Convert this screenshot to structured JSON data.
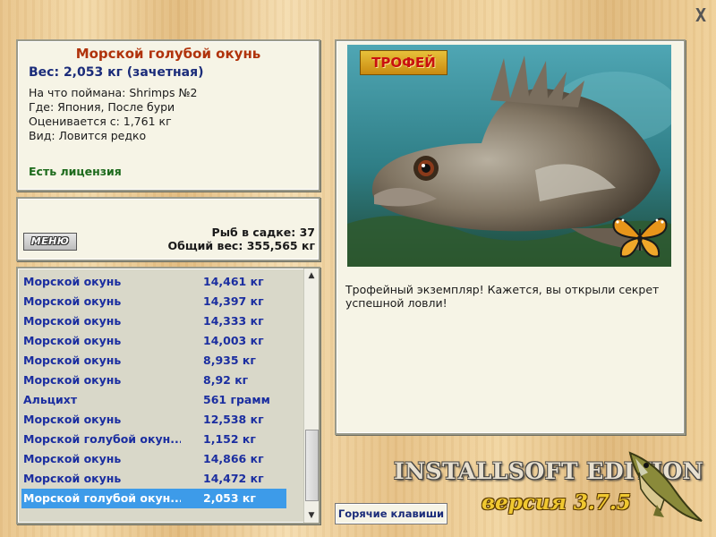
{
  "window": {
    "close_label": "X"
  },
  "info": {
    "fish_name": "Морской голубой окунь",
    "weight": "Вес: 2,053 кг (зачетная)",
    "bait": "На что поймана: Shrimps №2",
    "place": "Где: Япония, После бури",
    "estimated": "Оценивается с: 1,761 кг",
    "kind": "Вид: Ловится редко",
    "license": "Есть лицензия"
  },
  "menu": {
    "button_label": "МЕНЮ",
    "fish_in_keepnet": "Рыб в садке: 37",
    "total_weight": "Общий вес: 355,565 кг"
  },
  "catch_list": [
    {
      "name": "Морской окунь",
      "weight": "14,461 кг",
      "selected": false
    },
    {
      "name": "Морской окунь",
      "weight": "14,397 кг",
      "selected": false
    },
    {
      "name": "Морской окунь",
      "weight": "14,333 кг",
      "selected": false
    },
    {
      "name": "Морской окунь",
      "weight": "14,003 кг",
      "selected": false
    },
    {
      "name": "Морской окунь",
      "weight": "8,935 кг",
      "selected": false
    },
    {
      "name": "Морской окунь",
      "weight": "8,92 кг",
      "selected": false
    },
    {
      "name": "Альцихт",
      "weight": "561 грамм",
      "selected": false
    },
    {
      "name": "Морской окунь",
      "weight": "12,538 кг",
      "selected": false
    },
    {
      "name": "Морской голубой окун...",
      "weight": "1,152 кг",
      "selected": false
    },
    {
      "name": "Морской окунь",
      "weight": "14,866 кг",
      "selected": false
    },
    {
      "name": "Морской окунь",
      "weight": "14,472 кг",
      "selected": false
    },
    {
      "name": "Морской голубой окун...",
      "weight": "2,053 кг",
      "selected": true
    }
  ],
  "trophy": {
    "badge": "ТРОФЕЙ",
    "description": "Трофейный экземпляр! Кажется, вы открыли секрет успешной ловли!"
  },
  "footer": {
    "hotkeys_label": "Горячие клавиши",
    "edition": "INSTALLSOFT EDITION",
    "version": "версия 3.7.5"
  },
  "colors": {
    "title": "#b0330c",
    "list_text": "#1b2ea0",
    "selection": "#3d9be9",
    "license": "#1c6a1c"
  },
  "icons": [
    "close-icon",
    "scroll-up-icon",
    "scroll-down-icon",
    "butterfly-icon",
    "pike-logo-icon"
  ]
}
